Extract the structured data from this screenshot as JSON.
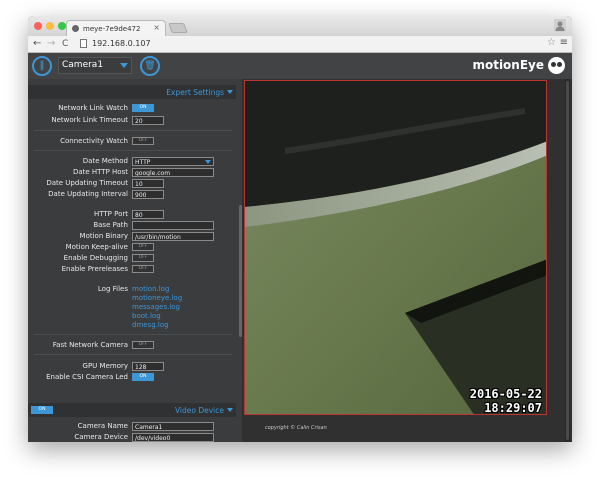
{
  "browser": {
    "tab_title": "meye-7e9de472",
    "tab_close": "×",
    "url": "192.168.0.107",
    "back": "←",
    "forward": "→",
    "reload": "C",
    "star": "☆",
    "menu": "≡",
    "traffic_lights": [
      "#fc605b",
      "#fdbc40",
      "#34c84a"
    ]
  },
  "header": {
    "menu_icon_glyph": "‖",
    "camera_select": "Camera1",
    "trash_icon_glyph": "🗑",
    "brand": "motionEye",
    "accent": "#3d97d6"
  },
  "expert": {
    "section_title": "Expert Settings",
    "network_link_watch": {
      "label": "Network Link Watch",
      "value": "ON"
    },
    "network_link_timeout": {
      "label": "Network Link Timeout",
      "value": "20"
    },
    "connectivity_watch": {
      "label": "Connectivity Watch",
      "value": "OFF"
    },
    "date_method": {
      "label": "Date Method",
      "value": "HTTP"
    },
    "date_http_host": {
      "label": "Date HTTP Host",
      "value": "google.com"
    },
    "date_updating_timeout": {
      "label": "Date Updating Timeout",
      "value": "10"
    },
    "date_updating_interval": {
      "label": "Date Updating Interval",
      "value": "900"
    },
    "http_port": {
      "label": "HTTP Port",
      "value": "80"
    },
    "base_path": {
      "label": "Base Path",
      "value": ""
    },
    "motion_binary": {
      "label": "Motion Binary",
      "value": "/usr/bin/motion"
    },
    "motion_keep_alive": {
      "label": "Motion Keep-alive",
      "value": "OFF"
    },
    "enable_debugging": {
      "label": "Enable Debugging",
      "value": "OFF"
    },
    "enable_prereleases": {
      "label": "Enable Prereleases",
      "value": "OFF"
    },
    "log_files": {
      "label": "Log Files",
      "items": [
        "motion.log",
        "motioneye.log",
        "messages.log",
        "boot.log",
        "dmesg.log"
      ]
    },
    "fast_network_camera": {
      "label": "Fast Network Camera",
      "value": "OFF"
    },
    "gpu_memory": {
      "label": "GPU Memory",
      "value": "128"
    },
    "enable_csi_camera_led": {
      "label": "Enable CSI Camera Led",
      "value": "ON"
    }
  },
  "video_device": {
    "section_title": "Video Device",
    "toggle_value": "ON",
    "camera_name": {
      "label": "Camera Name",
      "value": "Camera1"
    },
    "camera_device": {
      "label": "Camera Device",
      "value": "/dev/video0"
    }
  },
  "camera": {
    "timestamp_date": "2016-05-22",
    "timestamp_time": "18:29:07",
    "copyright": "copyright © Calin Crisan"
  }
}
